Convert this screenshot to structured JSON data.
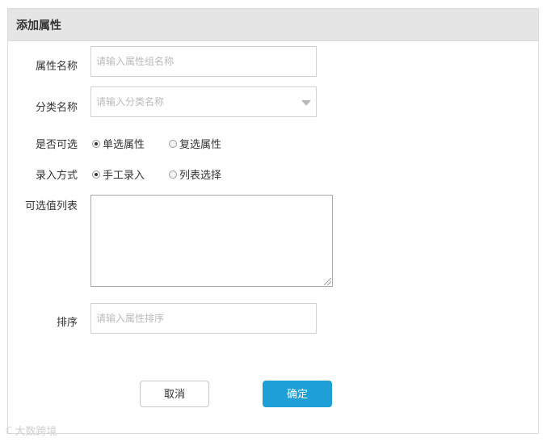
{
  "dialog": {
    "title": "添加属性"
  },
  "form": {
    "attr_name": {
      "label": "属性名称",
      "placeholder": "请输入属性组名称"
    },
    "category": {
      "label": "分类名称",
      "placeholder": "请输入分类名称"
    },
    "selectable": {
      "label": "是否可选",
      "options": [
        {
          "label": "单选属性",
          "checked": true
        },
        {
          "label": "复选属性",
          "checked": false
        }
      ]
    },
    "entry_mode": {
      "label": "录入方式",
      "options": [
        {
          "label": "手工录入",
          "checked": true
        },
        {
          "label": "列表选择",
          "checked": false
        }
      ]
    },
    "values_list": {
      "label": "可选值列表",
      "value": ""
    },
    "sort": {
      "label": "排序",
      "placeholder": "请输入属性排序"
    }
  },
  "buttons": {
    "cancel": "取消",
    "confirm": "确定"
  },
  "watermark": {
    "logo": "ℂ",
    "text": "大数跨境"
  },
  "colors": {
    "accent": "#1e9fd6",
    "header_bg": "#e5e5e5"
  }
}
